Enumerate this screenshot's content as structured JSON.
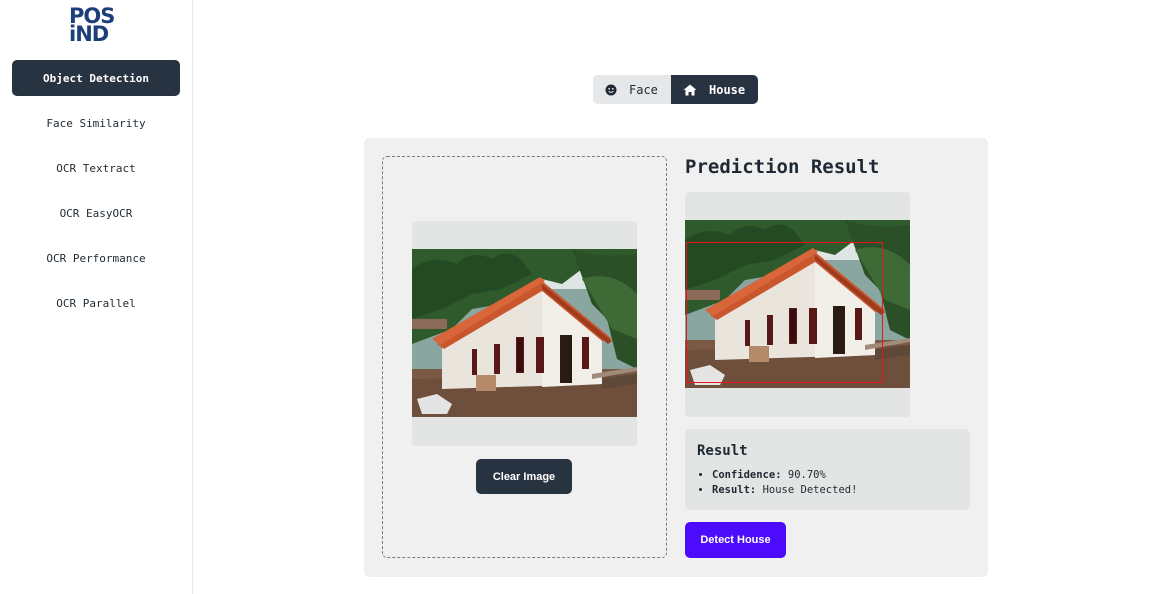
{
  "logo": {
    "line1": "POS",
    "line2": "iND"
  },
  "sidebar": {
    "items": [
      {
        "label": "Object Detection",
        "active": true
      },
      {
        "label": "Face Similarity",
        "active": false
      },
      {
        "label": "OCR Textract",
        "active": false
      },
      {
        "label": "OCR EasyOCR",
        "active": false
      },
      {
        "label": "OCR Performance",
        "active": false
      },
      {
        "label": "OCR Parallel",
        "active": false
      }
    ]
  },
  "mode_toggle": {
    "face": {
      "label": "Face",
      "icon": "smiley-icon"
    },
    "house": {
      "label": "House",
      "icon": "home-icon",
      "selected": true
    }
  },
  "upload": {
    "clear_label": "Clear Image",
    "image": "house-photo"
  },
  "prediction": {
    "title": "Prediction Result",
    "result_title": "Result",
    "confidence_label": "Confidence:",
    "confidence_value": "90.70%",
    "result_label": "Result:",
    "result_value": "House Detected!",
    "detect_label": "Detect House"
  },
  "colors": {
    "primary_dark": "#283341",
    "accent": "#4c0bfb",
    "bbox": "#e8141c",
    "brand": "#1c3f7a"
  }
}
